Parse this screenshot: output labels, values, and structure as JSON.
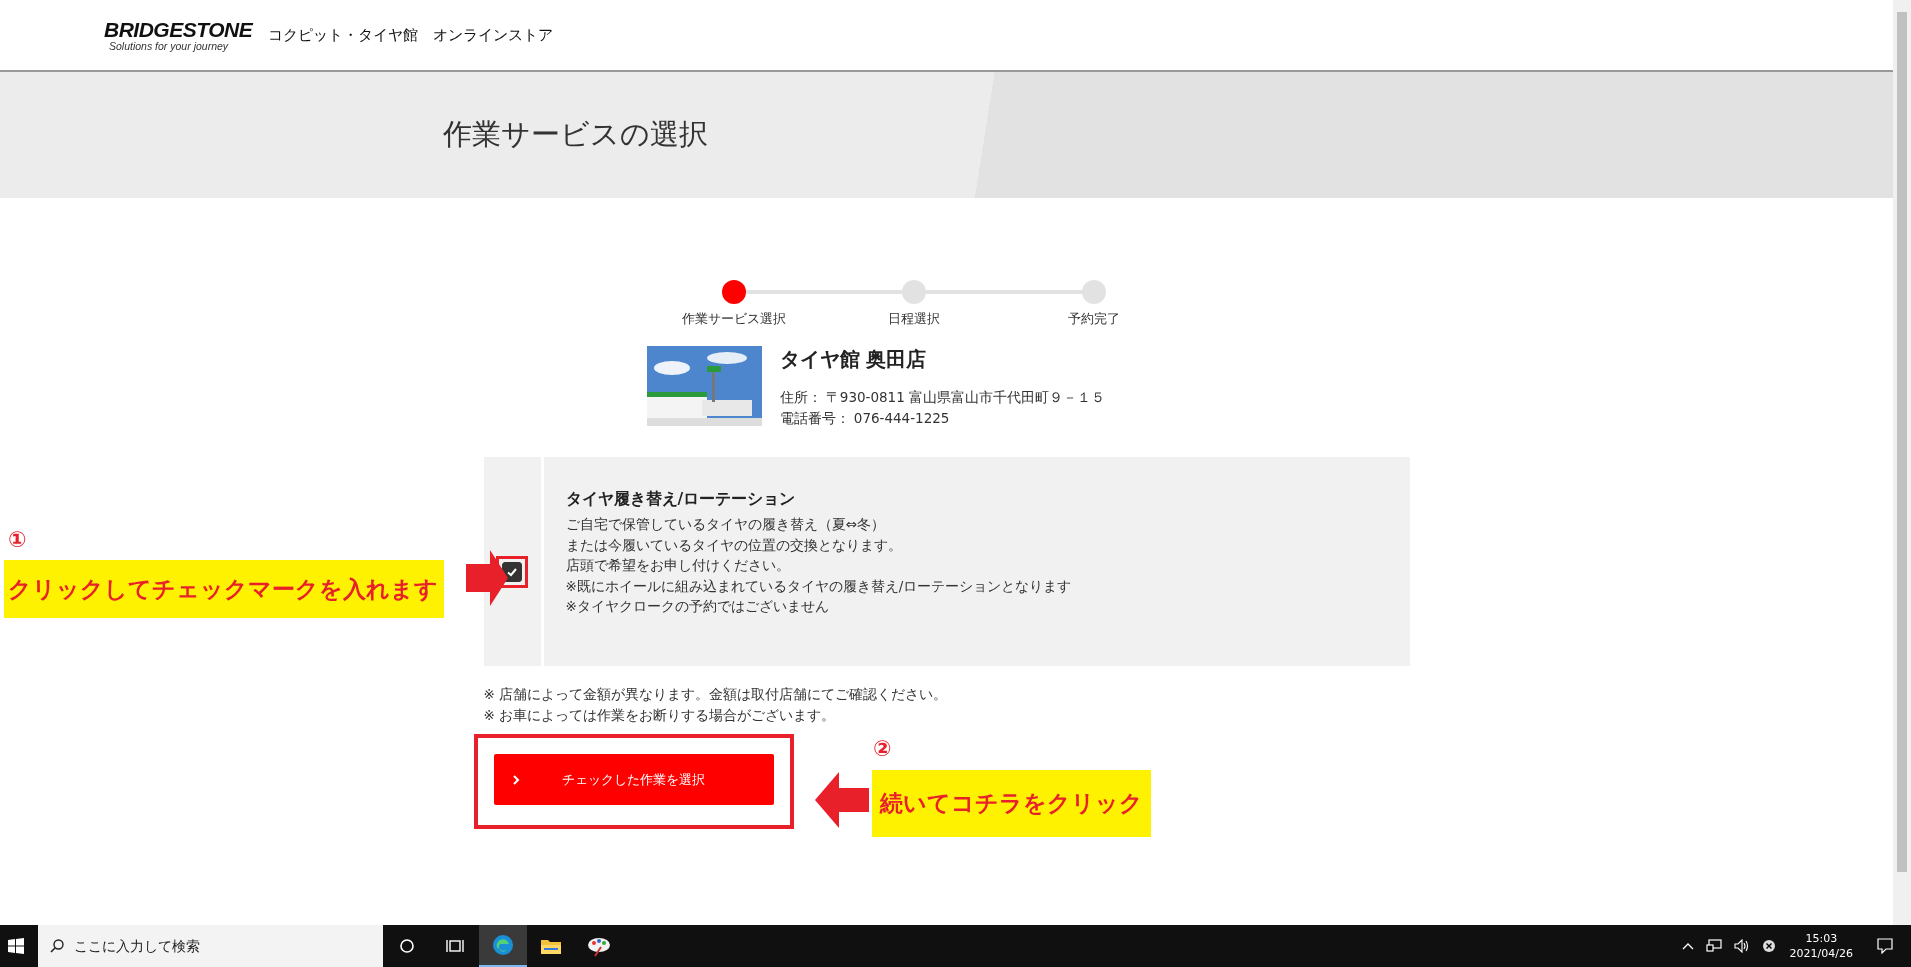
{
  "header": {
    "logo": {
      "wordmark": "BRIDGESTONE",
      "tagline": "Solutions for your journey"
    },
    "site_title": "コクピット・タイヤ館　オンラインストア"
  },
  "banner": {
    "title": "作業サービスの選択"
  },
  "steps": [
    {
      "label": "作業サービス選択",
      "selected": true
    },
    {
      "label": "日程選択",
      "selected": false
    },
    {
      "label": "予約完了",
      "selected": false
    }
  ],
  "store": {
    "name": "タイヤ館 奥田店",
    "address": "住所： 〒930-0811 富山県富山市千代田町９－１５",
    "phone": "電話番号： 076-444-1225"
  },
  "service": {
    "checked": true,
    "title": "タイヤ履き替え/ローテーション",
    "lines": [
      "ご自宅で保管しているタイヤの履き替え（夏⇔冬）",
      "または今履いているタイヤの位置の交換となります。",
      "店頭で希望をお申し付けください。",
      "※既にホイールに組み込まれているタイヤの履き替え/ローテーションとなります",
      "※タイヤクロークの予約ではございません"
    ]
  },
  "notes": [
    "※ 店舗によって金額が異なります。金額は取付店舗にてご確認ください。",
    "※ お車によっては作業をお断りする場合がございます。"
  ],
  "submit_button": {
    "label": "チェックした作業を選択"
  },
  "annotations": [
    {
      "kind": "checkbox",
      "number": "①",
      "text": "クリックしてチェックマークを入れます"
    },
    {
      "kind": "button",
      "number": "②",
      "text": "続いてコチラをクリック"
    }
  ],
  "taskbar": {
    "search": {
      "placeholder": "ここに入力して検索"
    },
    "apps": [
      {
        "kind": "cortana",
        "selected": false
      },
      {
        "kind": "taskview",
        "selected": false
      },
      {
        "kind": "edge",
        "selected": true
      },
      {
        "kind": "folder",
        "selected": false
      },
      {
        "kind": "paint",
        "selected": false
      }
    ],
    "clock": {
      "time": "15:03",
      "date": "2021/04/26"
    }
  }
}
